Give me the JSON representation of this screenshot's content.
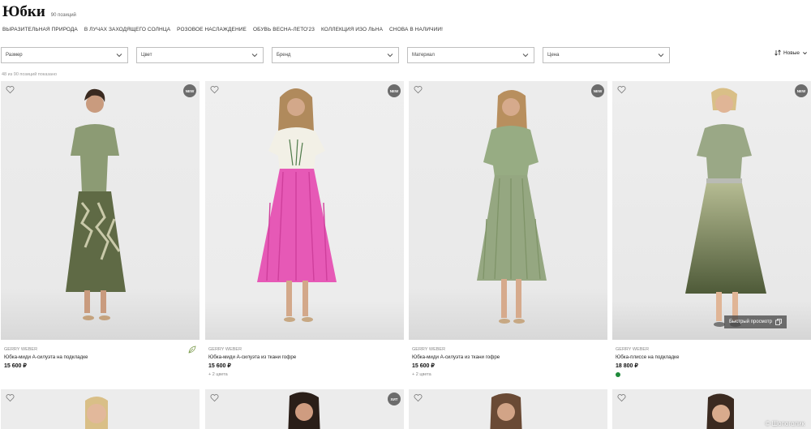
{
  "header": {
    "title": "Юбки",
    "count": "90 позиций"
  },
  "collections": [
    "ВЫРАЗИТЕЛЬНАЯ ПРИРОДА",
    "В ЛУЧАХ ЗАХОДЯЩЕГО СОЛНЦА",
    "РОЗОВОЕ НАСЛАЖДЕНИЕ",
    "ОБУВЬ ВЕСНА-ЛЕТО'23",
    "КОЛЛЕКЦИЯ ИЗО ЛЬНА",
    "СНОВА В НАЛИЧИИ!"
  ],
  "filters": [
    "Размер",
    "Цвет",
    "Бренд",
    "Материал",
    "Цена"
  ],
  "sort": {
    "label": "Новые",
    "icon": "sort-icon"
  },
  "shown": "48 из 90 позиций показано",
  "products": [
    {
      "badge": "NEW",
      "brand": "GERRY WEBER",
      "name": "Юбка-миди А-силуэта на подкладке",
      "price": "15 600 ₽",
      "extra": "",
      "skirt": "#5f6a45",
      "top": "#8c9b74"
    },
    {
      "badge": "NEW",
      "brand": "GERRY WEBER",
      "name": "Юбка-миди А-силуэта из ткани гофре",
      "price": "15 600 ₽",
      "extra": "+ 2 цвета",
      "skirt": "#e659b6",
      "top": "#efefe6"
    },
    {
      "badge": "NEW",
      "brand": "GERRY WEBER",
      "name": "Юбка-миди А-силуэта из ткани гофре",
      "price": "15 600 ₽",
      "extra": "+ 2 цвета",
      "skirt": "#95a781",
      "top": "#97ac83"
    },
    {
      "badge": "NEW",
      "brand": "GERRY WEBER",
      "name": "Юбка-плиссе на подкладке",
      "price": "18 800 ₽",
      "extra": "",
      "skirt": "#6d7a4f",
      "top": "#9aa886",
      "quick": "Быстрый просмотр",
      "dot": "#1f8a3a"
    }
  ],
  "row2_badges": [
    "",
    "ХИТ",
    "",
    ""
  ],
  "watermark": "© Шопоголик",
  "colors": {
    "text": "#222222",
    "border": "#bfbfbf",
    "badge": "#6c6c6c"
  }
}
